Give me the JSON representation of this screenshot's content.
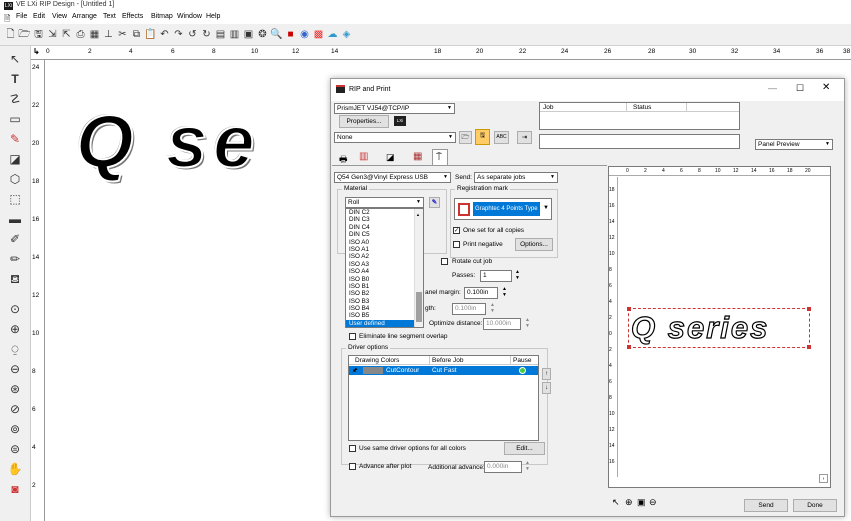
{
  "app": {
    "title": "VE LXi RIP Design - [Untitled 1]",
    "icon_text": "LXi"
  },
  "menu": [
    "File",
    "Edit",
    "View",
    "Arrange",
    "Text",
    "Effects",
    "Bitmap",
    "Window",
    "Help"
  ],
  "ruler_top": [
    "0",
    "2",
    "4",
    "6",
    "8",
    "10",
    "12",
    "14",
    "16",
    "18",
    "20",
    "22",
    "24",
    "26",
    "28",
    "30",
    "32",
    "34",
    "36",
    "38"
  ],
  "ruler_left": [
    "24",
    "22",
    "20",
    "18",
    "16",
    "14",
    "12",
    "10",
    "8",
    "6",
    "4",
    "2"
  ],
  "canvas": {
    "big_text": "Q se"
  },
  "dialog": {
    "title": "RIP and Print",
    "printer": "PrismJET VJ54@TCP/IP",
    "properties_button": "Properties...",
    "properties_badge": "LXi",
    "setup": "None",
    "job_table": {
      "headers": [
        "Job",
        "Status"
      ]
    },
    "panel_preview": "Panel Preview",
    "device": "Q54 Gen3@Vinyl Express USB",
    "send_label": "Send:",
    "send_value": "As separate jobs",
    "material": {
      "label": "Material",
      "value": "Roll",
      "options": [
        "DIN C2",
        "DIN C3",
        "DIN C4",
        "DIN C5",
        "ISO A0",
        "ISO A1",
        "ISO A2",
        "ISO A3",
        "ISO A4",
        "ISO B0",
        "ISO B1",
        "ISO B2",
        "ISO B3",
        "ISO B4",
        "ISO B5",
        "User defined"
      ],
      "selected": "User defined"
    },
    "registration": {
      "label": "Registration mark",
      "value": "Graphtec 4 Points Type",
      "one_set": "One set for all copies",
      "print_negative": "Print negative",
      "options_button": "Options..."
    },
    "rotate_cut": "Rotate cut job",
    "passes_label": "Passes:",
    "passes_value": "1",
    "panel_margin_label": "anel margin:",
    "panel_margin_value": "0.100in",
    "gth_label": "gth:",
    "gth_value": "0.100in",
    "optimize_label": "Optimize distance:",
    "optimize_value": "10.000in",
    "eliminate": "Eliminate line segment overlap",
    "driver": {
      "label": "Driver options",
      "headers": [
        "Drawing Colors",
        "Before Job",
        "Pause"
      ],
      "row": {
        "color": "CutContour",
        "before": "Cut Fast"
      },
      "edit_button": "Edit...",
      "same_opts": "Use same driver options for all colors"
    },
    "advance": "Advance after plot",
    "additional_advance_label": "Additional advance:",
    "additional_advance_value": "0.000in",
    "preview": {
      "text": "Q series",
      "ruler_top": [
        "0",
        "2",
        "4",
        "6",
        "8",
        "10",
        "12",
        "14",
        "16",
        "18",
        "20"
      ],
      "ruler_left": [
        "18",
        "16",
        "14",
        "12",
        "10",
        "8",
        "6",
        "4",
        "2",
        "0",
        "2",
        "4",
        "6",
        "8",
        "10",
        "12",
        "14",
        "16"
      ]
    },
    "send_button": "Send",
    "done_button": "Done"
  },
  "colors": {
    "selection": "#0078d7",
    "accent": "#3399ff"
  }
}
